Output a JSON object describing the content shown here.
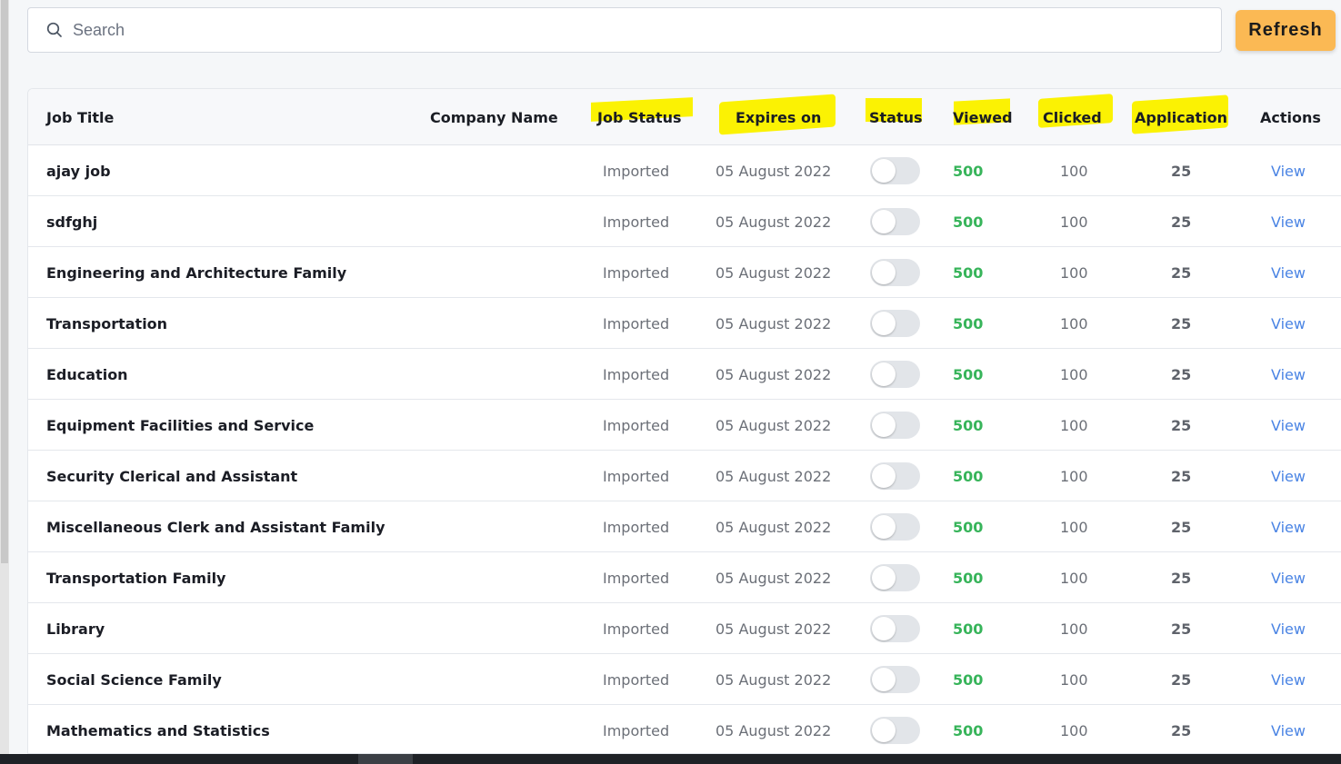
{
  "search": {
    "placeholder": "Search"
  },
  "toolbar": {
    "refresh_label": "Refresh"
  },
  "table": {
    "headers": {
      "job_title": "Job Title",
      "company_name": "Company Name",
      "job_status": "Job Status",
      "expires_on": "Expires on",
      "status": "Status",
      "viewed": "Viewed",
      "clicked": "Clicked",
      "application": "Application",
      "actions": "Actions"
    },
    "highlighted_headers": [
      "Job Status",
      "Expires on",
      "Status",
      "Viewed",
      "Clicked",
      "Application"
    ],
    "rows": [
      {
        "title": "ajay job",
        "job_status": "Imported",
        "expires": "05 August 2022",
        "status_on": false,
        "viewed": "500",
        "clicked": "100",
        "application": "25",
        "action": "View"
      },
      {
        "title": "sdfghj",
        "job_status": "Imported",
        "expires": "05 August 2022",
        "status_on": false,
        "viewed": "500",
        "clicked": "100",
        "application": "25",
        "action": "View"
      },
      {
        "title": "Engineering and Architecture Family",
        "job_status": "Imported",
        "expires": "05 August 2022",
        "status_on": false,
        "viewed": "500",
        "clicked": "100",
        "application": "25",
        "action": "View"
      },
      {
        "title": "Transportation",
        "job_status": "Imported",
        "expires": "05 August 2022",
        "status_on": false,
        "viewed": "500",
        "clicked": "100",
        "application": "25",
        "action": "View"
      },
      {
        "title": "Education",
        "job_status": "Imported",
        "expires": "05 August 2022",
        "status_on": false,
        "viewed": "500",
        "clicked": "100",
        "application": "25",
        "action": "View"
      },
      {
        "title": "Equipment Facilities and Service",
        "job_status": "Imported",
        "expires": "05 August 2022",
        "status_on": false,
        "viewed": "500",
        "clicked": "100",
        "application": "25",
        "action": "View"
      },
      {
        "title": "Security Clerical and Assistant",
        "job_status": "Imported",
        "expires": "05 August 2022",
        "status_on": false,
        "viewed": "500",
        "clicked": "100",
        "application": "25",
        "action": "View"
      },
      {
        "title": "Miscellaneous Clerk and Assistant Family",
        "job_status": "Imported",
        "expires": "05 August 2022",
        "status_on": false,
        "viewed": "500",
        "clicked": "100",
        "application": "25",
        "action": "View"
      },
      {
        "title": "Transportation Family",
        "job_status": "Imported",
        "expires": "05 August 2022",
        "status_on": false,
        "viewed": "500",
        "clicked": "100",
        "application": "25",
        "action": "View"
      },
      {
        "title": "Library",
        "job_status": "Imported",
        "expires": "05 August 2022",
        "status_on": false,
        "viewed": "500",
        "clicked": "100",
        "application": "25",
        "action": "View"
      },
      {
        "title": "Social Science Family",
        "job_status": "Imported",
        "expires": "05 August 2022",
        "status_on": false,
        "viewed": "500",
        "clicked": "100",
        "application": "25",
        "action": "View"
      },
      {
        "title": "Mathematics and Statistics",
        "job_status": "Imported",
        "expires": "05 August 2022",
        "status_on": false,
        "viewed": "500",
        "clicked": "100",
        "application": "25",
        "action": "View"
      }
    ]
  },
  "colors": {
    "refresh_button": "#fbb954",
    "highlight": "#fbf203",
    "viewed_text": "#37b45a",
    "link": "#4a84e4"
  },
  "icons": {
    "search": "search-icon"
  }
}
